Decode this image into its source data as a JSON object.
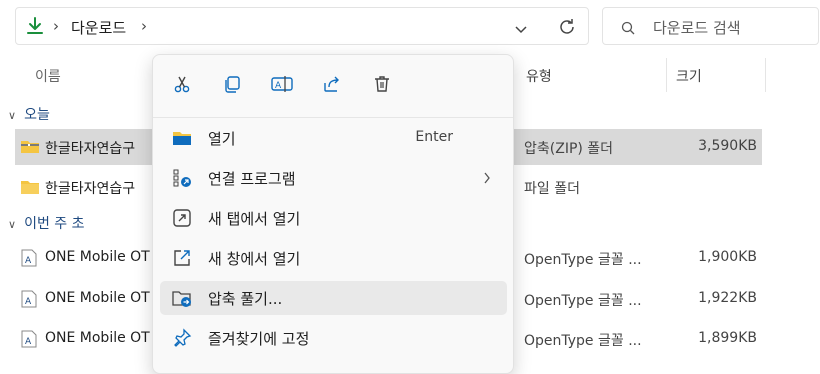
{
  "address": {
    "crumbs": [
      "다운로드"
    ],
    "separator": "›"
  },
  "search": {
    "placeholder": "다운로드 검색"
  },
  "columns": {
    "name": "이름",
    "type": "유형",
    "size": "크기"
  },
  "groups": [
    {
      "label": "오늘",
      "rows": [
        {
          "name": "한글타자연습구",
          "type": "압축(ZIP) 폴더",
          "size": "3,590KB",
          "icon": "zip-folder-icon",
          "selected": true
        },
        {
          "name": "한글타자연습구",
          "type": "파일 폴더",
          "size": "",
          "icon": "folder-icon",
          "selected": false
        }
      ]
    },
    {
      "label": "이번 주 초",
      "rows": [
        {
          "name": "ONE Mobile OT",
          "type": "OpenType 글꼴 ...",
          "size": "1,900KB",
          "icon": "font-file-icon"
        },
        {
          "name": "ONE Mobile OT",
          "type": "OpenType 글꼴 ...",
          "size": "1,922KB",
          "icon": "font-file-icon"
        },
        {
          "name": "ONE Mobile OT",
          "type": "OpenType 글꼴 ...",
          "size": "1,899KB",
          "icon": "font-file-icon"
        }
      ]
    }
  ],
  "context_menu": {
    "toolbar": [
      "cut-icon",
      "copy-icon",
      "rename-icon",
      "share-icon",
      "delete-icon"
    ],
    "items": [
      {
        "label": "열기",
        "shortcut": "Enter",
        "icon": "open-folder-icon"
      },
      {
        "label": "연결 프로그램",
        "submenu": "›",
        "icon": "open-with-icon"
      },
      {
        "label": "새 탭에서 열기",
        "icon": "new-tab-icon"
      },
      {
        "label": "새 창에서 열기",
        "icon": "new-window-icon"
      },
      {
        "label": "압축 풀기...",
        "icon": "extract-icon",
        "hovered": true
      },
      {
        "label": "즐겨찾기에 고정",
        "icon": "pin-icon"
      }
    ]
  },
  "colors": {
    "accent": "#0f6cbd",
    "folder": "#f4c542",
    "selection": "#d9d9d9",
    "download_arrow": "#1a8f3c"
  }
}
